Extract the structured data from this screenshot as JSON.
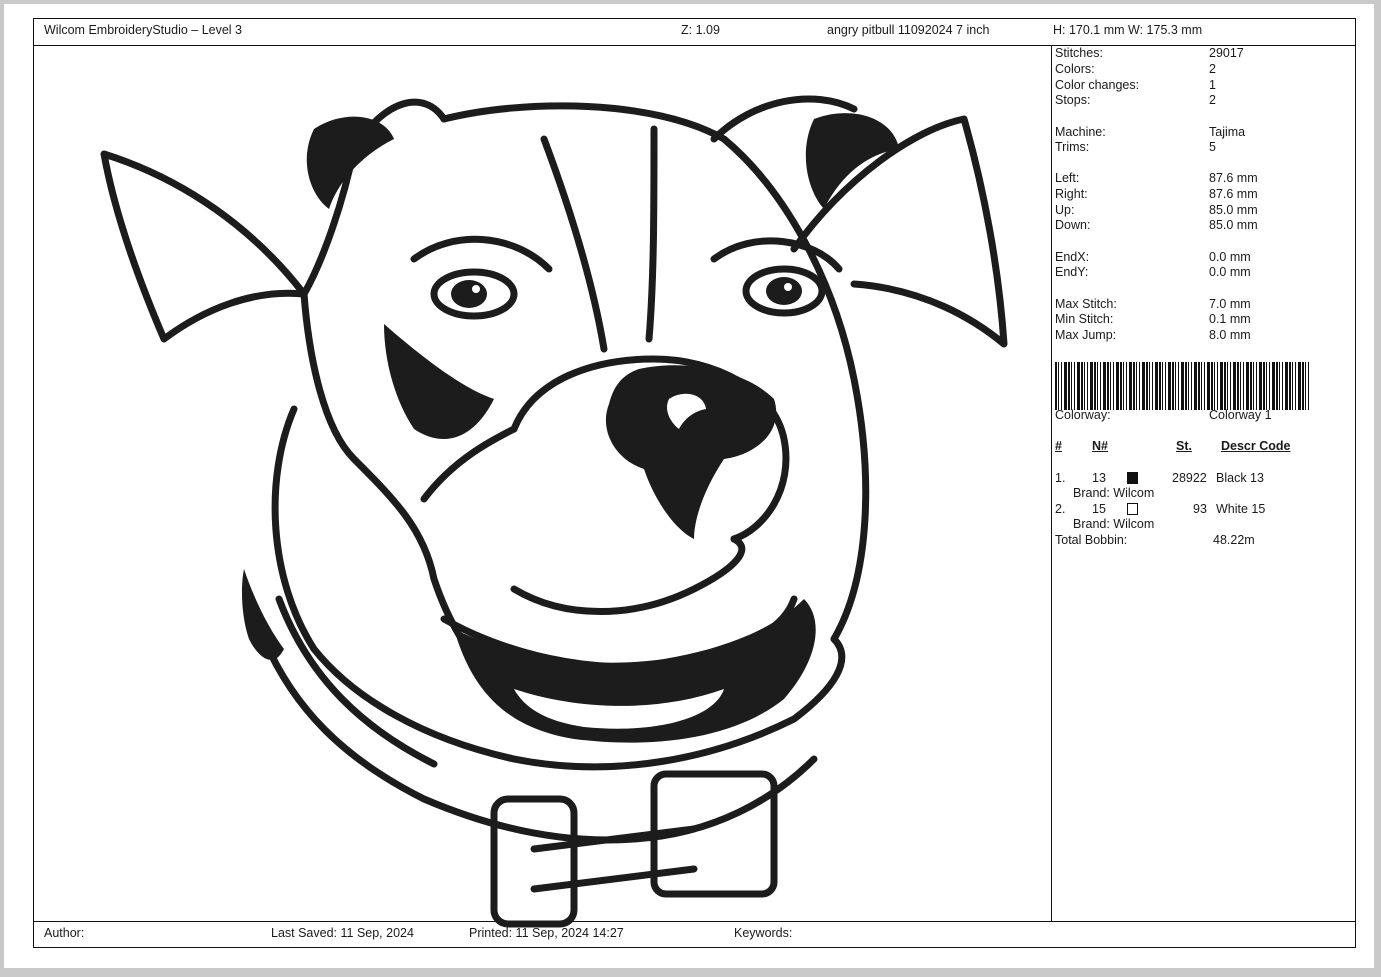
{
  "header": {
    "app": "Wilcom EmbroideryStudio – Level 3",
    "zoom": "Z: 1.09",
    "design_name": "angry pitbull  11092024 7 inch",
    "size": "H: 170.1 mm   W: 175.3 mm"
  },
  "stats": [
    {
      "label": "Stitches:",
      "value": "29017"
    },
    {
      "label": "Colors:",
      "value": "2"
    },
    {
      "label": "Color changes:",
      "value": "1"
    },
    {
      "label": "Stops:",
      "value": "2"
    },
    {
      "label": "Machine:",
      "value": "Tajima"
    },
    {
      "label": "Trims:",
      "value": "5"
    },
    {
      "label": "Left:",
      "value": "87.6 mm"
    },
    {
      "label": "Right:",
      "value": "87.6 mm"
    },
    {
      "label": "Up:",
      "value": "85.0 mm"
    },
    {
      "label": "Down:",
      "value": "85.0 mm"
    },
    {
      "label": "EndX:",
      "value": "0.0 mm"
    },
    {
      "label": "EndY:",
      "value": "0.0 mm"
    },
    {
      "label": "Max Stitch:",
      "value": "7.0 mm"
    },
    {
      "label": "Min Stitch:",
      "value": "0.1 mm"
    },
    {
      "label": "Max Jump:",
      "value": "8.0 mm"
    }
  ],
  "colorway": {
    "label": "Colorway:",
    "value": "Colorway 1"
  },
  "table": {
    "headers": {
      "num": "#",
      "n": "N#",
      "st": "St.",
      "descr": "Descr  Code"
    },
    "rows": [
      {
        "idx": "1.",
        "n": "13",
        "swatch": "#111111",
        "st": "28922",
        "descr": "Black 13",
        "brand": "Brand: Wilcom"
      },
      {
        "idx": "2.",
        "n": "15",
        "swatch": "#ffffff",
        "st": "93",
        "descr": "White 15",
        "brand": "Brand: Wilcom"
      }
    ],
    "bobbin_label": "Total Bobbin:",
    "bobbin_value": "48.22m"
  },
  "footer": {
    "author": "Author:",
    "last_saved": "Last Saved: 11 Sep, 2024",
    "printed": "Printed: 11 Sep, 2024  14:27",
    "keywords": "Keywords:"
  },
  "colors": {
    "stitch": "#1c1c1c",
    "background": "#c9c9c9"
  }
}
